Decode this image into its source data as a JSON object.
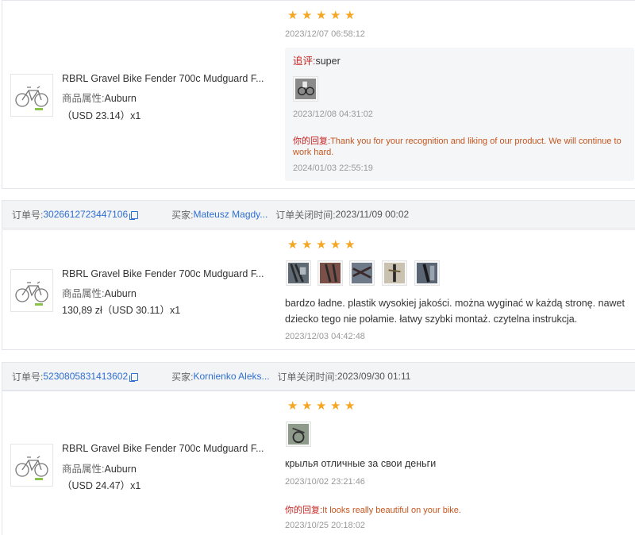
{
  "labels": {
    "order_no": "订单号:",
    "buyer": "买家:",
    "close_time": "订单关闭时间:",
    "attr": "商品属性:",
    "follow_up": "追评:",
    "your_reply": "你的回复:"
  },
  "card1": {
    "product_title": "RBRL Gravel Bike Fender 700c Mudguard F...",
    "attr_value": "Auburn",
    "price": "（USD  23.14）x1",
    "rating": 5,
    "review_date": "2023/12/07 06:58:12",
    "follow_text": "super",
    "follow_date": "2023/12/08 04:31:02",
    "reply_text": "Thank you for your recognition and liking of our product. We will continue to work hard.",
    "reply_date": "2024/01/03 22:55:19"
  },
  "order2": {
    "order_no": "3026612723447106",
    "buyer": "Mateusz Magdy...",
    "close_time": "2023/11/09 00:02"
  },
  "card2": {
    "product_title": "RBRL Gravel Bike Fender 700c Mudguard F...",
    "attr_value": "Auburn",
    "price": "130,89 zł（USD  30.11）x1",
    "rating": 5,
    "review_text": "bardzo ładne. plastik wysokiej jakości. można wyginać w każdą stronę. nawet dziecko tego nie połamie. łatwy szybki montaż. czytelna instrukcja.",
    "review_date": "2023/12/03 04:42:48"
  },
  "order3": {
    "order_no": "5230805831413602",
    "buyer": "Kornienko Aleks...",
    "close_time": "2023/09/30 01:11"
  },
  "card3": {
    "product_title": "RBRL Gravel Bike Fender 700c Mudguard F...",
    "attr_value": "Auburn",
    "price": "（USD  24.47）x1",
    "rating": 5,
    "review_text": "крылья отличные за свои деньги",
    "review_date": "2023/10/02 23:21:46",
    "reply_text": "It looks really beautiful on your bike.",
    "reply_date": "2023/10/25 20:18:02"
  },
  "colors": {
    "link": "#2f6fd1",
    "star": "#f5a623",
    "reply": "#c5561f",
    "follow_label": "#c5221f"
  }
}
